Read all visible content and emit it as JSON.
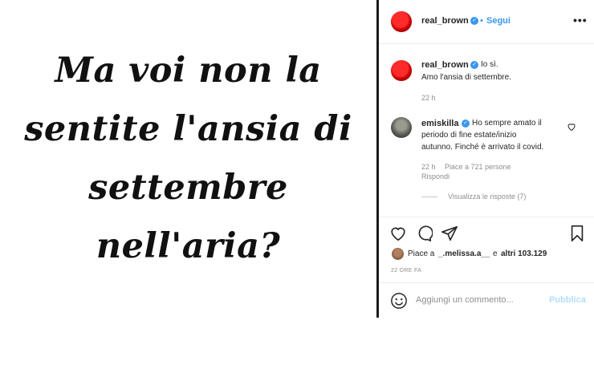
{
  "post": {
    "image_text": "Ma voi non la\nsentite l'ansia di\nsettembre\nnell'aria?"
  },
  "header": {
    "username": "real_brown",
    "follow_label": "Segui",
    "dot": "•",
    "more_label": "•••"
  },
  "caption": {
    "username": "real_brown",
    "line1": "Io sì.",
    "line2": "Amo l'ansia di settembre.",
    "time": "22 h"
  },
  "comment": {
    "username": "emiskilla",
    "line1": "Ho sempre amato il",
    "line2": "periodo di fine estate/inizio",
    "line3": "autunno. Finché è arrivato il covid.",
    "time": "22 h",
    "likes": "Piace a 721 persone",
    "reply_label": "Rispondi",
    "view_replies": "Visualizza le risposte (7)"
  },
  "actions": {
    "likes_prefix": "Piace a",
    "likes_user": "_.melissa.a__",
    "likes_middle": "e",
    "likes_others": "altri 103.129",
    "time_ago": "22 ORE FA"
  },
  "comment_box": {
    "placeholder": "Aggiungi un commento...",
    "publish_label": "Pubblica"
  },
  "colors": {
    "accent": "#3897f0",
    "publish_disabled": "#b2dffc",
    "muted": "#8e8e8e"
  }
}
